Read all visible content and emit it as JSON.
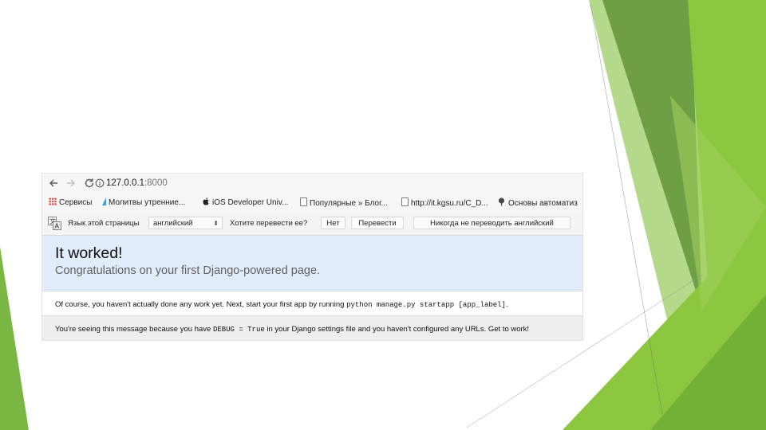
{
  "browser": {
    "url_host": "127.0.0.1",
    "url_port": ":8000"
  },
  "bookmarks": [
    {
      "label": "Сервисы",
      "icon": "apps-grid-icon"
    },
    {
      "label": "Молитвы утренние...",
      "icon": "bookmark-flag-icon"
    },
    {
      "label": "iOS Developer Univ...",
      "icon": "apple-icon"
    },
    {
      "label": "Популярные » Блог...",
      "icon": "document-icon"
    },
    {
      "label": "http://it.kgsu.ru/C_D...",
      "icon": "document-icon"
    },
    {
      "label": "Основы автоматиз",
      "icon": "tree-icon"
    }
  ],
  "translate": {
    "label": "Язык этой страницы",
    "language": "английский",
    "question": "Хотите перевести ее?",
    "no": "Нет",
    "translate": "Перевести",
    "never": "Никогда не переводить английский"
  },
  "page": {
    "title": "It worked!",
    "subtitle": "Congratulations on your first Django-powered page.",
    "msg1_before": "Of course, you haven't actually done any work yet. Next, start your first app by running ",
    "msg1_code": "python manage.py startapp [app_label]",
    "msg1_after": ".",
    "msg2_before": "You're seeing this message because you have ",
    "msg2_code": "DEBUG = True",
    "msg2_after": " in your Django settings file and you haven't configured any URLs. Get to work!"
  },
  "colors": {
    "hero_bg": "#e1ecfb",
    "accent_green_dark": "#5e9f32",
    "accent_green_light": "#8cc63f"
  }
}
